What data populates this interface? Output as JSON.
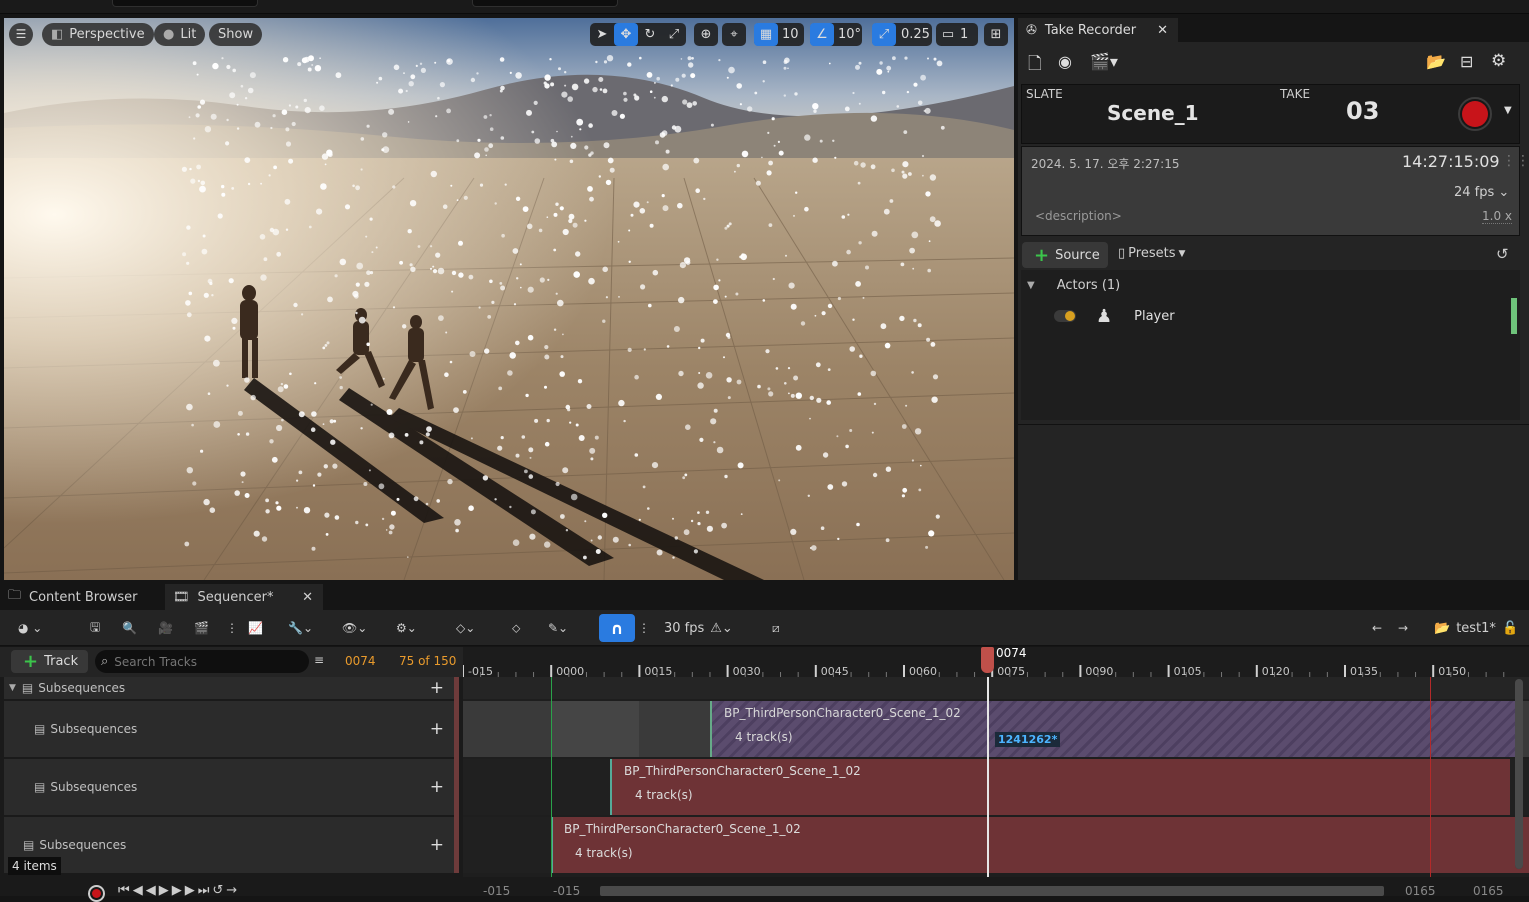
{
  "viewport": {
    "menu_label": "",
    "perspective_label": "Perspective",
    "lit_label": "Lit",
    "show_label": "Show",
    "grid_snap_value": "10",
    "rotation_snap_value": "10°",
    "scale_snap_value": "0.25",
    "camera_speed_value": "1"
  },
  "take_recorder": {
    "tab_title": "Take Recorder",
    "slate_label": "SLATE",
    "slate_value": "Scene_1",
    "take_label": "TAKE",
    "take_value": "03",
    "date_text": "2024. 5. 17. 오후 2:27:15",
    "timecode": "14:27:15:09",
    "fps_value": "24 fps",
    "description_placeholder": "<description>",
    "time_scale": "1.0 x",
    "add_source_label": "Source",
    "presets_label": "Presets",
    "actors_group_label": "Actors (1)",
    "actor_name": "Player",
    "record_color": "#c8141a"
  },
  "bottom_tabs": {
    "content_browser_label": "Content Browser",
    "sequencer_label": "Sequencer*"
  },
  "sequencer": {
    "fps_label": "30 fps",
    "sequence_name": "test1*",
    "add_track_label": "Track",
    "search_placeholder": "Search Tracks",
    "current_frame": "0074",
    "frame_count": "75 of 150",
    "playhead_label": "0074",
    "ruler_ticks": [
      "-015",
      "0000",
      "0015",
      "0030",
      "0045",
      "0060",
      "0075",
      "0090",
      "0105",
      "0120",
      "0135",
      "0150"
    ],
    "track_rows": [
      {
        "label": "Subsequences"
      },
      {
        "label": "Subsequences"
      },
      {
        "label": "Subsequences"
      },
      {
        "label": "Subsequences"
      }
    ],
    "sections": [
      {
        "name": "BP_ThirdPersonCharacter0_Scene_1_02",
        "tracks": "4 track(s)",
        "badge": "1241262*"
      },
      {
        "name": "BP_ThirdPersonCharacter0_Scene_1_02",
        "tracks": "4 track(s)"
      },
      {
        "name": "BP_ThirdPersonCharacter0_Scene_1_02",
        "tracks": "4 track(s)"
      }
    ],
    "items_count": "4 items",
    "bottom_range_left_a": "-015",
    "bottom_range_left_b": "-015",
    "bottom_range_right_a": "0165",
    "bottom_range_right_b": "0165"
  }
}
